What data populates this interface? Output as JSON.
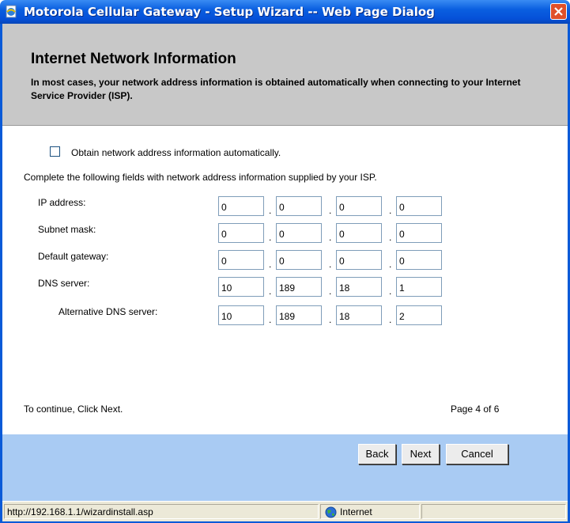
{
  "window": {
    "title": "Motorola Cellular Gateway - Setup Wizard -- Web Page Dialog",
    "app_icon": "ie-page-icon",
    "close_icon": "close-icon"
  },
  "header": {
    "title": "Internet Network Information",
    "description": "In most cases, your network address information is obtained automatically when connecting to your Internet Service Provider (ISP)."
  },
  "auto": {
    "label": "Obtain network address information automatically.",
    "checked": false
  },
  "instructions": "Complete the following fields with network address information supplied by your ISP.",
  "fields": [
    {
      "label": "IP address:",
      "octets": [
        "0",
        "0",
        "0",
        "0"
      ]
    },
    {
      "label": "Subnet mask:",
      "octets": [
        "0",
        "0",
        "0",
        "0"
      ]
    },
    {
      "label": "Default gateway:",
      "octets": [
        "0",
        "0",
        "0",
        "0"
      ]
    },
    {
      "label": "DNS server:",
      "octets": [
        "10",
        "189",
        "18",
        "1"
      ]
    },
    {
      "label": "Alternative DNS server:",
      "octets": [
        "10",
        "189",
        "18",
        "2"
      ]
    }
  ],
  "separator": ".",
  "footer": {
    "continue_text": "To continue, Click Next.",
    "page_text": "Page 4 of 6"
  },
  "buttons": {
    "back": "Back",
    "next": "Next",
    "cancel": "Cancel"
  },
  "status": {
    "url": "http://192.168.1.1/wizardinstall.asp",
    "zone": "Internet",
    "zone_icon": "globe-icon"
  },
  "colors": {
    "titlebar": "#0a5fe0",
    "header_bg": "#c8c8c8",
    "footer_bg": "#a9cbf3",
    "close_button": "#e0502a"
  }
}
